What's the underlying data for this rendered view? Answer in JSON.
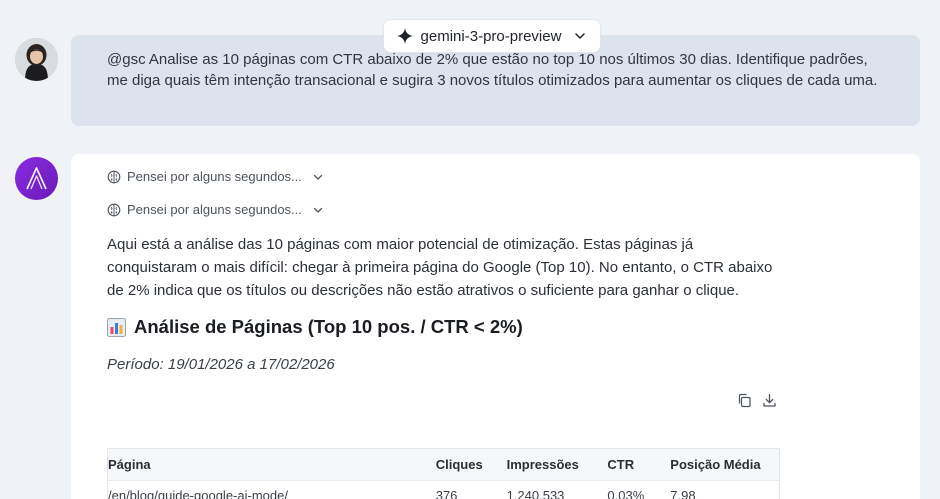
{
  "header": {
    "model_name": "gemini-3-pro-preview"
  },
  "user_message": {
    "text": "@gsc Analise as 10 páginas com CTR abaixo de 2% que estão no top 10 nos últimos 30 dias. Identifique padrões, me diga quais têm intenção transacional e sugira 3 novos títulos otimizados para aumentar os cliques de cada uma."
  },
  "assistant": {
    "thoughts": [
      {
        "label": "Pensei por alguns segundos..."
      },
      {
        "label": "Pensei por alguns segundos..."
      }
    ],
    "intro": "Aqui está a análise das 10 páginas com maior potencial de otimização. Estas páginas já conquistaram o mais difícil: chegar à primeira página do Google (Top 10). No entanto, o CTR abaixo de 2% indica que os títulos ou descrições não estão atrativos o suficiente para ganhar o clique.",
    "heading_emoji": "📊",
    "heading": "Análise de Páginas (Top 10 pos. / CTR < 2%)",
    "period": "Período: 19/01/2026 a 17/02/2026",
    "table": {
      "headers": [
        "Página",
        "Cliques",
        "Impressões",
        "CTR",
        "Posição Média"
      ],
      "rows": [
        [
          "/en/blog/guide-google-ai-mode/",
          "376",
          "1.240.533",
          "0,03%",
          "7,98"
        ]
      ]
    }
  },
  "colors": {
    "background": "#eff2f7",
    "user_bubble": "#dde3ec",
    "bot_avatar": "#8a2be2"
  }
}
